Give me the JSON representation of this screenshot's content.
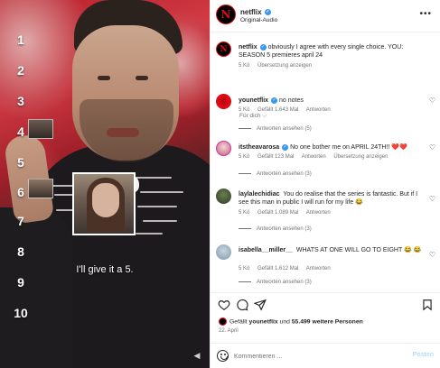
{
  "video": {
    "rank_labels": [
      "1",
      "2",
      "3",
      "4",
      "5",
      "6",
      "7",
      "8",
      "9",
      "10"
    ],
    "caption": "I'll give it a 5."
  },
  "post": {
    "account": "netflix",
    "audio": "Original-Audio",
    "avatar_letter": "N",
    "caption": {
      "username": "netflix",
      "text": "obviously I agree with every single choice. YOU: SEASON 5 premieres april 24",
      "age": "5 Kö",
      "translate": "Übersetzung anzeigen"
    },
    "for_you": "Für dich ⌵"
  },
  "comments": [
    {
      "username": "younetflix",
      "verified": true,
      "text": "no notes",
      "age": "5 Kö",
      "likes": "Gefällt 1.643 Mal",
      "reply": "Antworten",
      "translate": "",
      "replies": "Antworten ansehen (5)"
    },
    {
      "username": "itstheavarosa",
      "verified": true,
      "text": "No one bother me on APRIL 24TH!! ❤️❤️",
      "age": "5 Kö",
      "likes": "Gefällt 123 Mal",
      "reply": "Antworten",
      "translate": "Übersetzung anzeigen",
      "replies": "Antworten ansehen (3)"
    },
    {
      "username": "laylalechidiac",
      "verified": false,
      "text": "You do realise that the series is fantastic. But if I see this man in public I will run for my life 😂",
      "age": "5 Kö",
      "likes": "Gefällt 1.089 Mal",
      "reply": "Antworten",
      "translate": "",
      "replies": "Antworten ansehen (3)"
    },
    {
      "username": "isabella__miller__",
      "verified": false,
      "text": "WHATS AT ONE WILL GO TO EIGHT 😂 😂",
      "age": "5 Kö",
      "likes": "Gefällt 1.612 Mal",
      "reply": "Antworten",
      "translate": "",
      "replies": "Antworten ansehen (3)"
    }
  ],
  "likes": {
    "prefix": "Gefällt ",
    "user": "younetflix",
    "middle": " und ",
    "count": "55.499 weitere Personen"
  },
  "date": "22. April",
  "composer": {
    "placeholder": "Kommentieren ...",
    "post_label": "Posten"
  }
}
